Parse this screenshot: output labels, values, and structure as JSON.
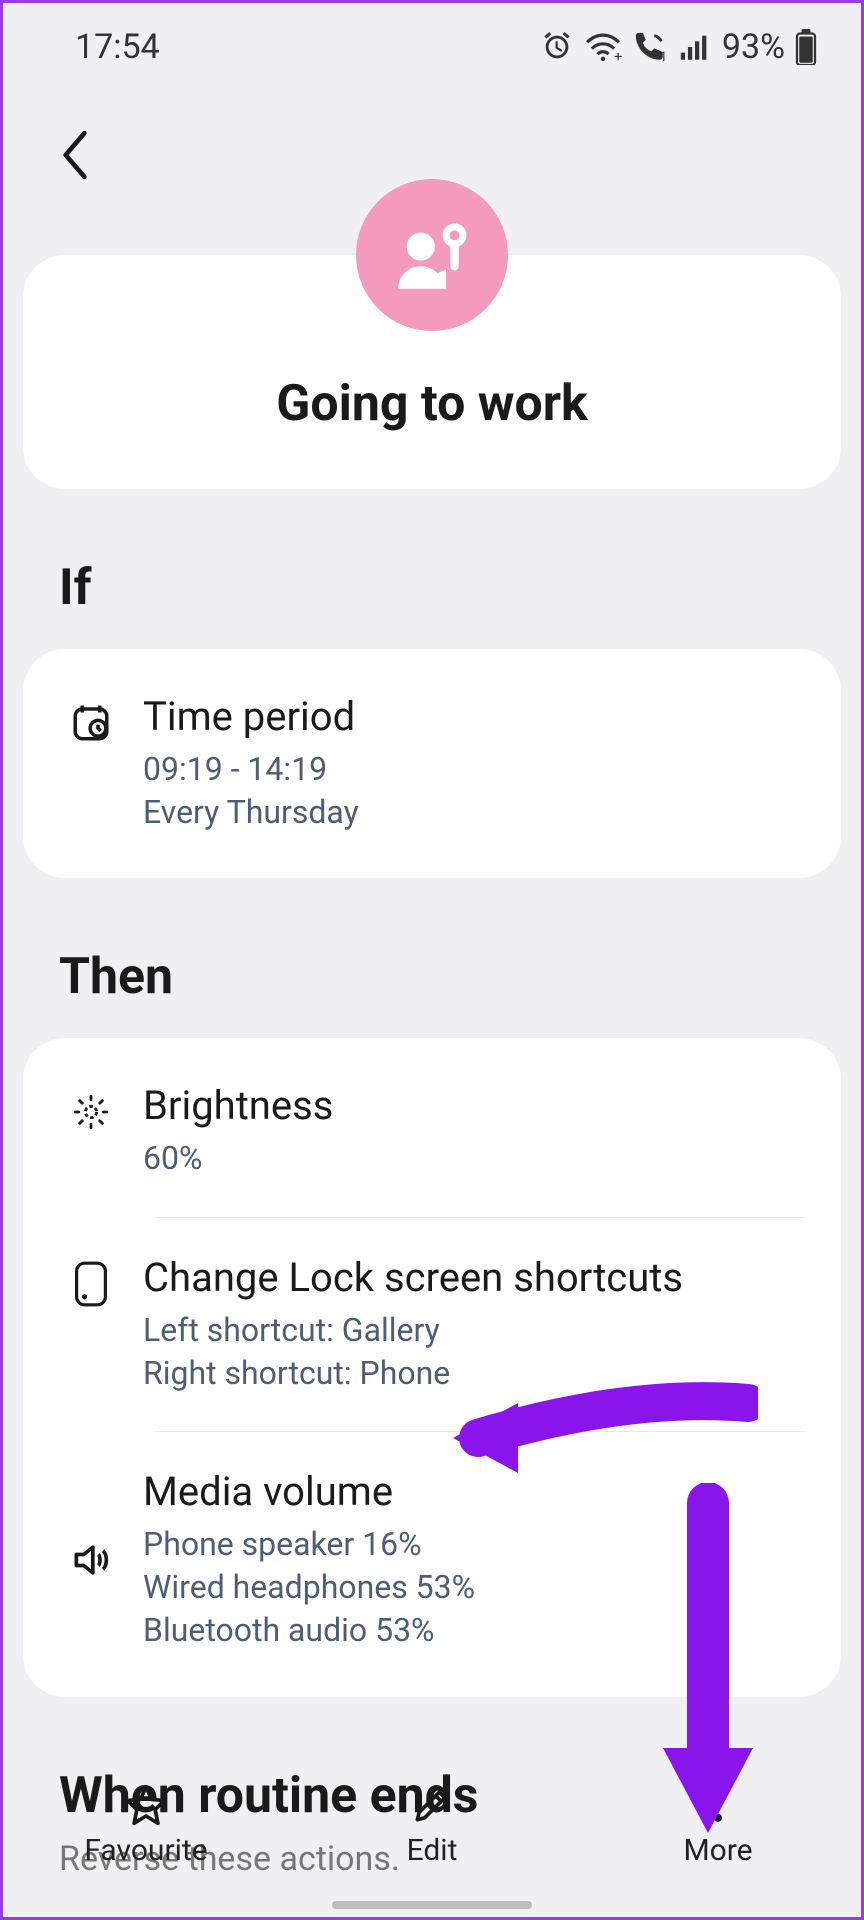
{
  "status": {
    "time": "17:54",
    "battery_pct": "93%"
  },
  "routine_title": "Going to work",
  "section_if": "If",
  "section_then": "Then",
  "if_items": [
    {
      "title": "Time period",
      "sub1": "09:19 - 14:19",
      "sub2": "Every Thursday"
    }
  ],
  "then_items": [
    {
      "title": "Brightness",
      "sub1": "60%"
    },
    {
      "title": "Change Lock screen shortcuts",
      "sub1": "Left shortcut: Gallery",
      "sub2": "Right shortcut: Phone"
    },
    {
      "title": "Media volume",
      "sub1": "Phone speaker 16%",
      "sub2": "Wired headphones 53%",
      "sub3": "Bluetooth audio 53%"
    }
  ],
  "ends": {
    "header": "When routine ends",
    "hint": "Reverse these actions."
  },
  "bottom_bar": {
    "favourite": "Favourite",
    "edit": "Edit",
    "more": "More"
  }
}
